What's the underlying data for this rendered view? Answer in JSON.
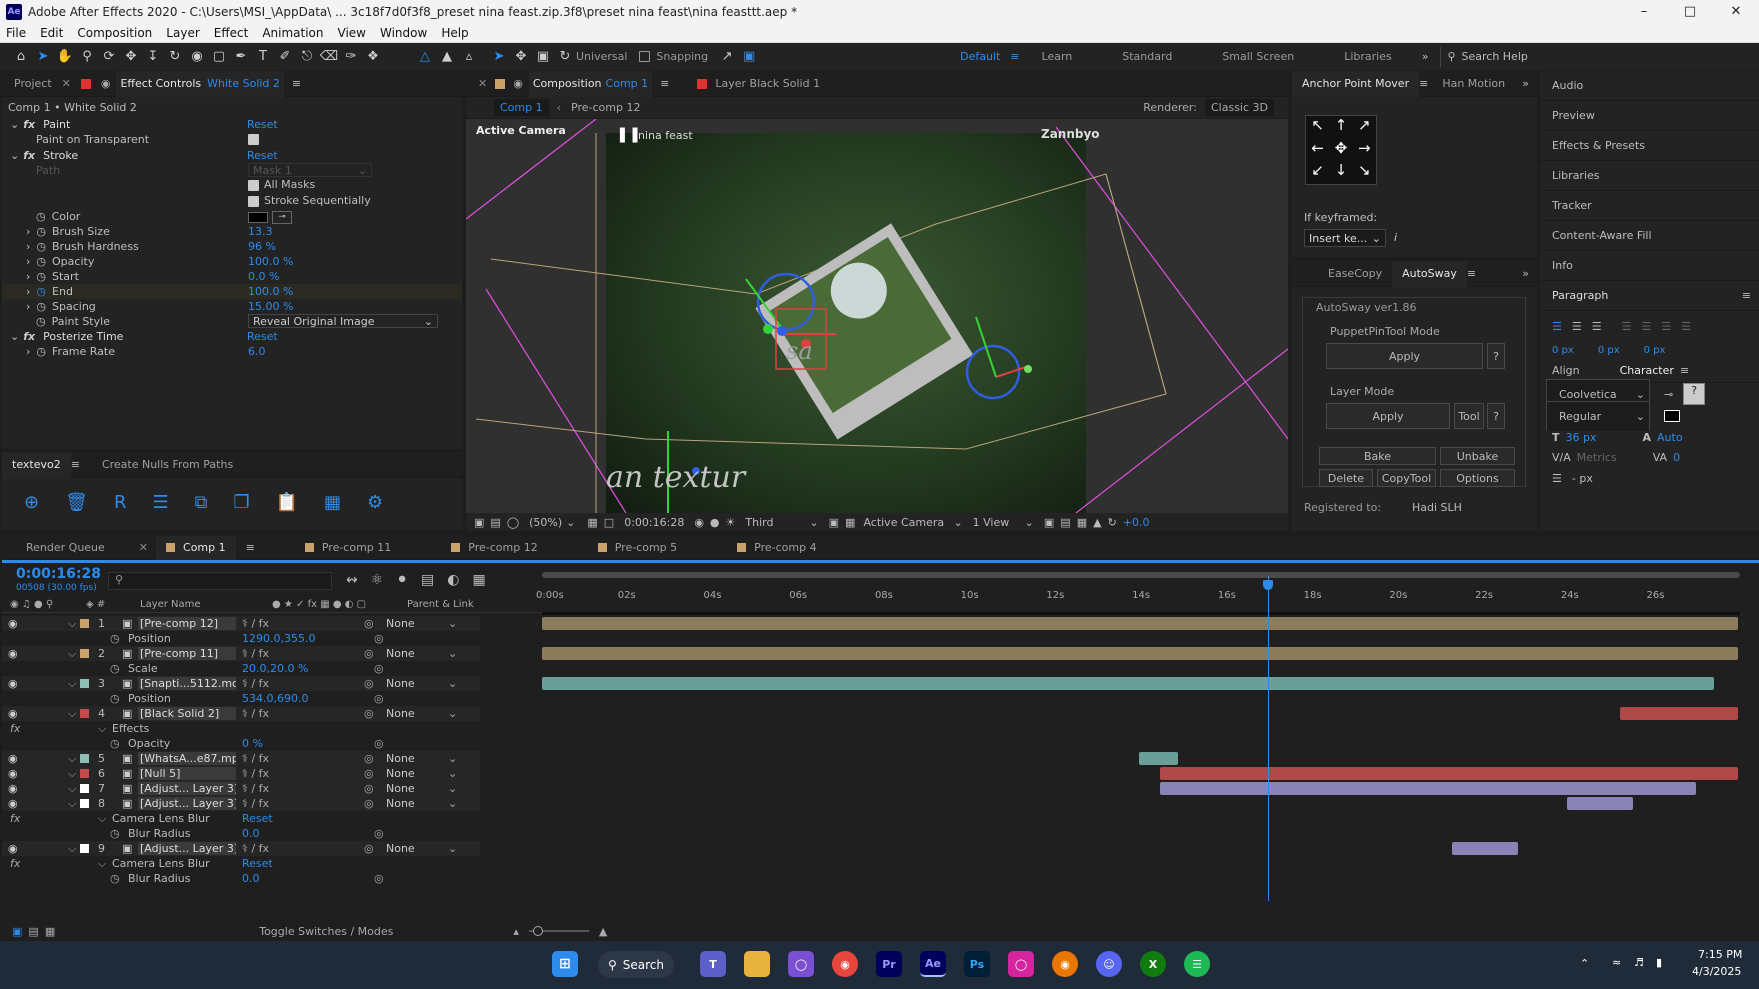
{
  "titlebar": {
    "title": "Adobe After Effects 2020 - C:\\Users\\MSI_\\AppData\\ ... 3c18f7d0f3f8_preset nina feast.zip.3f8\\preset nina feast\\nina feasttt.aep *"
  },
  "menu": [
    "File",
    "Edit",
    "Composition",
    "Layer",
    "Effect",
    "Animation",
    "View",
    "Window",
    "Help"
  ],
  "toolbar": {
    "universal": "Universal",
    "snapping": "Snapping",
    "workspaces": [
      "Default",
      "Learn",
      "Standard",
      "Small Screen",
      "Libraries"
    ],
    "search": "Search Help"
  },
  "left_panel": {
    "tab_project": "Project",
    "tab_effect_controls": "Effect Controls",
    "tab_layer": "White Solid 2",
    "header": "Comp 1 • White Solid 2",
    "paint": {
      "name": "Paint",
      "reset": "Reset",
      "paint_on_transparent": "Paint on Transparent"
    },
    "stroke": {
      "name": "Stroke",
      "reset": "Reset",
      "path": "Path",
      "path_val": "Mask 1",
      "all_masks": "All Masks",
      "stroke_seq": "Stroke Sequentially",
      "color": "Color",
      "brush_size": "Brush Size",
      "brush_size_val": "13.3",
      "brush_hardness": "Brush Hardness",
      "brush_hardness_val": "96 %",
      "opacity": "Opacity",
      "opacity_val": "100.0 %",
      "start": "Start",
      "start_val": "0.0 %",
      "end": "End",
      "end_val": "100.0 %",
      "spacing": "Spacing",
      "spacing_val": "15.00 %",
      "paint_style": "Paint Style",
      "paint_style_val": "Reveal Original Image"
    },
    "posterize": {
      "name": "Posterize Time",
      "reset": "Reset",
      "frame_rate": "Frame Rate",
      "frame_rate_val": "6.0"
    },
    "bottom_tabs": [
      "textevo2",
      "Create Nulls From Paths"
    ]
  },
  "composition": {
    "tab": "Composition",
    "tab_comp": "Comp 1",
    "tab_layer": "Layer Black Solid 1",
    "sub_tabs": [
      "Comp 1",
      "Pre-comp 12"
    ],
    "renderer_label": "Renderer:",
    "renderer": "Classic 3D",
    "active_camera": "Active Camera",
    "overlay_text": "nina feast",
    "watermark": "Zannbyo",
    "magnification": "(50%)",
    "timecode": "0:00:16:28",
    "resolution": "Third",
    "camera_select": "Active Camera",
    "view_select": "1 View",
    "exposure": "+0.0"
  },
  "anchor": {
    "tab": "Anchor Point Mover",
    "tab2": "Han Motion",
    "if_keyframed": "If keyframed:",
    "insert": "Insert ke..."
  },
  "autosway": {
    "tab1": "EaseCopy",
    "tab2": "AutoSway",
    "version": "AutoSway ver1.86",
    "puppet_mode": "PuppetPinTool Mode",
    "apply": "Apply",
    "q": "?",
    "layer_mode": "Layer Mode",
    "tool": "Tool",
    "bake": "Bake",
    "unbake": "Unbake",
    "delete": "Delete",
    "copytool": "CopyTool",
    "options": "Options",
    "registered": "Registered to:",
    "registered_name": "Hadi SLH"
  },
  "right_panel": {
    "items": [
      "Audio",
      "Preview",
      "Effects & Presets",
      "Libraries",
      "Tracker",
      "Content-Aware Fill",
      "Info"
    ],
    "paragraph": "Paragraph",
    "px_vals": [
      "0 px",
      "0 px",
      "0 px"
    ],
    "align": "Align",
    "character": "Character",
    "font": "Coolvetica",
    "style": "Regular",
    "font_size": "36 px",
    "leading": "Auto",
    "kerning": "Metrics",
    "tracking": "0",
    "indent": "- px"
  },
  "timeline": {
    "tabs": [
      "Render Queue",
      "Comp 1",
      "Pre-comp 11",
      "Pre-comp 12",
      "Pre-comp 5",
      "Pre-comp 4"
    ],
    "tab_colors": [
      "#444",
      "#c9a36a",
      "#c9a36a",
      "#c9a36a",
      "#c9a36a",
      "#c9a36a"
    ],
    "timecode": "0:00:16:28",
    "frames": "00508 (30.00 fps)",
    "col_layer_name": "Layer Name",
    "col_parent": "Parent & Link",
    "ruler": [
      "0:00s",
      "02s",
      "04s",
      "06s",
      "08s",
      "10s",
      "12s",
      "14s",
      "16s",
      "18s",
      "20s",
      "22s",
      "24s",
      "26s"
    ],
    "rows": [
      {
        "kind": "layer",
        "num": "1",
        "name": "[Pre-comp 12]",
        "parent": "None",
        "label": "#c9a36a",
        "bar": {
          "from": 0,
          "to": 1,
          "color": "#8b7d5c"
        }
      },
      {
        "kind": "prop",
        "name": "Position",
        "value": "1290.0,355.0"
      },
      {
        "kind": "layer",
        "num": "2",
        "name": "[Pre-comp 11]",
        "parent": "None",
        "label": "#c9a36a",
        "bar": {
          "from": 0,
          "to": 1,
          "color": "#8b7d5c"
        }
      },
      {
        "kind": "prop",
        "name": "Scale",
        "value": "20.0,20.0 %"
      },
      {
        "kind": "layer",
        "num": "3",
        "name": "[Snapti...5112.mov]",
        "parent": "None",
        "label": "#8fbfb4",
        "bar": {
          "from": 0,
          "to": 0.98,
          "color": "#6a9e96"
        }
      },
      {
        "kind": "prop",
        "name": "Position",
        "value": "534.0,690.0"
      },
      {
        "kind": "layer",
        "num": "4",
        "name": "[Black Solid 2]",
        "parent": "None",
        "label": "#c44b4b",
        "bar": {
          "from": 0.901,
          "to": 1,
          "color": "#b04848"
        }
      },
      {
        "kind": "group",
        "name": "Effects"
      },
      {
        "kind": "prop",
        "name": "Opacity",
        "value": "0 %"
      },
      {
        "kind": "layer",
        "num": "5",
        "name": "[WhatsA...e87.mp4]",
        "parent": "None",
        "label": "#8fbfb4",
        "bar": {
          "from": 0.499,
          "to": 0.532,
          "color": "#6a9e96"
        }
      },
      {
        "kind": "layer",
        "num": "6",
        "name": "[Null 5]",
        "parent": "None",
        "label": "#c44b4b",
        "bar": {
          "from": 0.517,
          "to": 1,
          "color": "#b04848"
        }
      },
      {
        "kind": "layer",
        "num": "7",
        "name": "[Adjust... Layer 3]",
        "parent": "None",
        "label": "#ffffff",
        "bar": {
          "from": 0.517,
          "to": 0.965,
          "color": "#8a83b5"
        }
      },
      {
        "kind": "layer",
        "num": "8",
        "name": "[Adjust... Layer 3]",
        "parent": "None",
        "label": "#ffffff",
        "bar": {
          "from": 0.857,
          "to": 0.912,
          "color": "#8a83b5"
        }
      },
      {
        "kind": "group",
        "name": "Camera Lens Blur",
        "value": "Reset"
      },
      {
        "kind": "prop",
        "name": "Blur Radius",
        "value": "0.0"
      },
      {
        "kind": "layer",
        "num": "9",
        "name": "[Adjust... Layer 3]",
        "parent": "None",
        "label": "#ffffff",
        "bar": {
          "from": 0.761,
          "to": 0.816,
          "color": "#8a83b5"
        }
      },
      {
        "kind": "group",
        "name": "Camera Lens Blur",
        "value": "Reset"
      },
      {
        "kind": "prop",
        "name": "Blur Radius",
        "value": "0.0"
      }
    ],
    "toggle": "Toggle Switches / Modes"
  },
  "taskbar": {
    "search": "Search",
    "time": "7:15 PM",
    "date": "4/3/2025"
  }
}
